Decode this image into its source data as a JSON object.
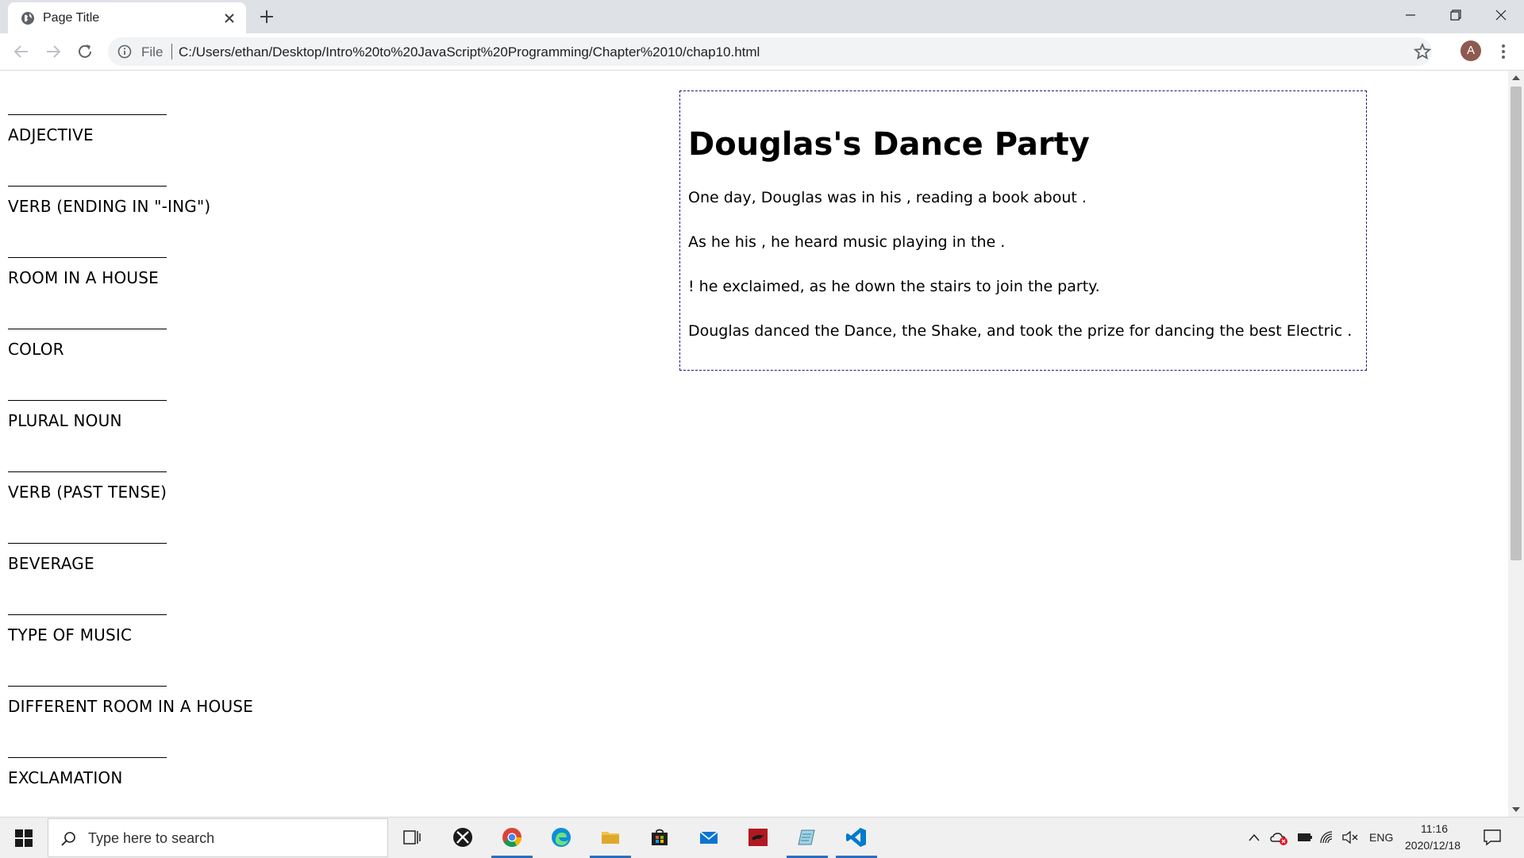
{
  "browser": {
    "tab_title": "Page Title",
    "omnibox": {
      "scheme_label": "File",
      "url": "C:/Users/ethan/Desktop/Intro%20to%20JavaScript%20Programming/Chapter%2010/chap10.html"
    },
    "profile_initial": "A"
  },
  "form": {
    "fields": [
      {
        "label": "ADJECTIVE"
      },
      {
        "label": "VERB (ENDING IN \"-ING\")"
      },
      {
        "label": "ROOM IN A HOUSE"
      },
      {
        "label": "COLOR"
      },
      {
        "label": "PLURAL NOUN"
      },
      {
        "label": "VERB (PAST TENSE)"
      },
      {
        "label": "BEVERAGE"
      },
      {
        "label": "TYPE OF MUSIC"
      },
      {
        "label": "DIFFERENT ROOM IN A HOUSE"
      },
      {
        "label": "EXCLAMATION"
      }
    ]
  },
  "story": {
    "title": "Douglas's Dance Party",
    "paragraphs": [
      "One day, Douglas was in his , reading a book about .",
      "As he his , he heard music playing in the .",
      "! he exclaimed, as he down the stairs to join the party.",
      "Douglas danced the Dance, the Shake, and took the prize for dancing the best Electric ."
    ]
  },
  "taskbar": {
    "search_placeholder": "Type here to search",
    "language": "ENG",
    "time": "11:16",
    "date": "2020/12/18"
  }
}
